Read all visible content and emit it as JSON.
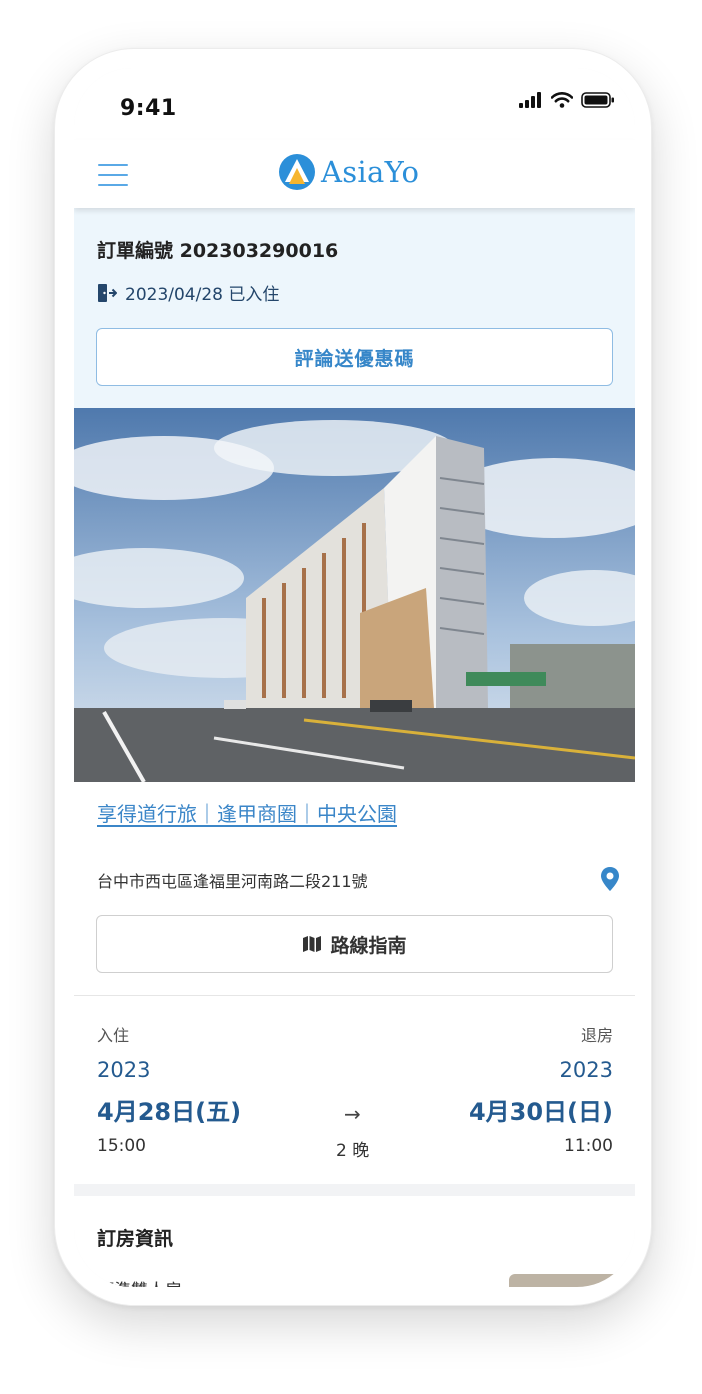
{
  "status_bar": {
    "time": "9:41"
  },
  "header": {
    "logo_text": "AsiaYo"
  },
  "order": {
    "number_text": "訂單編號 202303290016",
    "checkin_status": "2023/04/28 已入住",
    "review_button_label": "評論送優惠碼"
  },
  "hotel": {
    "name": "享得道行旅｜逢甲商圈｜中央公園",
    "address": "台中市西屯區逢福里河南路二段211號",
    "route_button_label": "路線指南"
  },
  "stay": {
    "checkin_label": "入住",
    "checkout_label": "退房",
    "checkin_year": "2023",
    "checkout_year": "2023",
    "checkin_date": "4月28日(五)",
    "checkout_date": "4月30日(日)",
    "arrow": "→",
    "nights": "2 晚",
    "checkin_time": "15:00",
    "checkout_time": "11:00"
  },
  "booking": {
    "title": "訂房資訊",
    "room_name": "標準雙人房"
  },
  "colors": {
    "brand_blue": "#2b8fd9",
    "brand_yellow": "#f6b52e",
    "date_blue": "#245a8f",
    "order_bg": "#edf6fc"
  },
  "icons": [
    "signal-icon",
    "wifi-icon",
    "battery-icon",
    "menu-icon",
    "logo-icon",
    "checkin-door-icon",
    "location-pin-icon",
    "map-icon"
  ]
}
